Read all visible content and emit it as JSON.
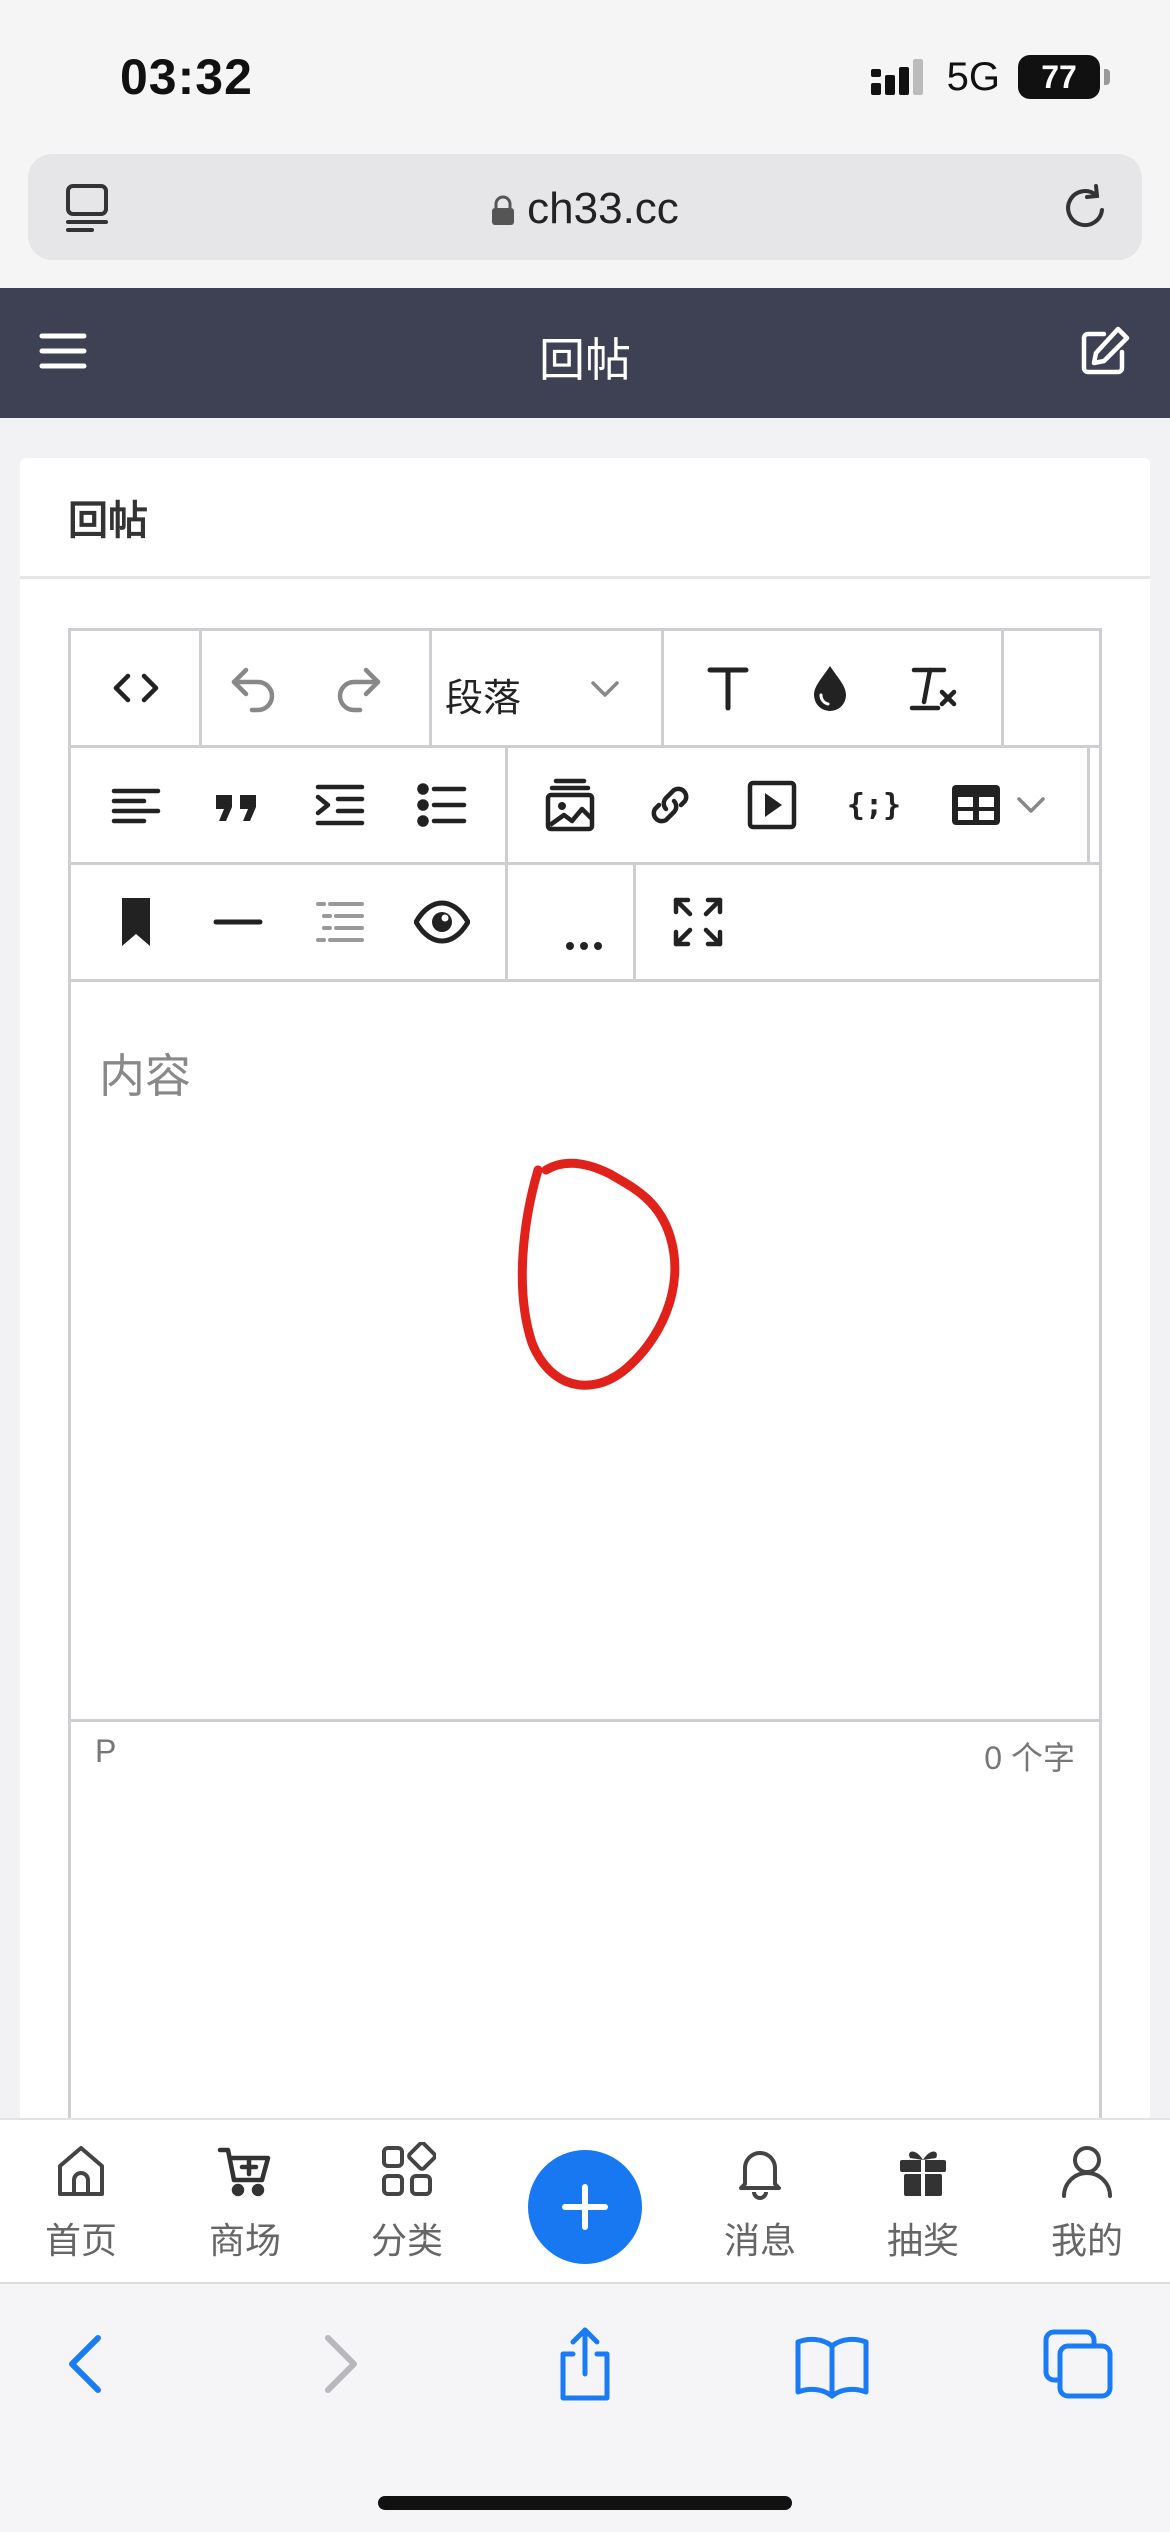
{
  "status_bar": {
    "time": "03:32",
    "network": "5G",
    "battery": "77"
  },
  "browser": {
    "url": "ch33.cc"
  },
  "header": {
    "title": "回帖"
  },
  "card": {
    "title": "回帖"
  },
  "editor": {
    "block_format": "段落",
    "placeholder": "内容",
    "path": "P",
    "word_count": "0 个字"
  },
  "bottom_nav": {
    "items": [
      {
        "label": "首页",
        "icon": "home-icon"
      },
      {
        "label": "商场",
        "icon": "cart-icon"
      },
      {
        "label": "分类",
        "icon": "category-icon"
      },
      {
        "label": "消息",
        "icon": "bell-icon"
      },
      {
        "label": "抽奖",
        "icon": "gift-icon"
      },
      {
        "label": "我的",
        "icon": "user-icon"
      }
    ]
  },
  "colors": {
    "header_bg": "#3e4153",
    "accent": "#1778f2",
    "safari_blue": "#1a7cf5",
    "annotation": "#e0221b"
  }
}
